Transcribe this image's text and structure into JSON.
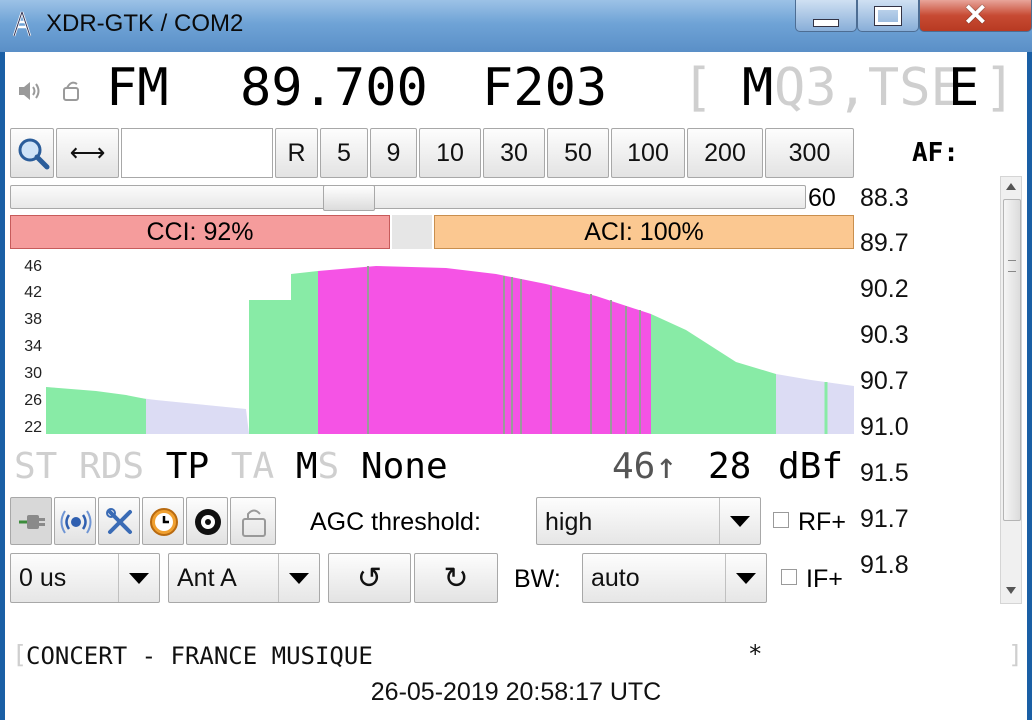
{
  "window": {
    "title": "XDR-GTK / COM2"
  },
  "tuner": {
    "band": "FM",
    "frequency": "89.700",
    "pi": "F203",
    "bracket_open": "[",
    "ps_m": "M",
    "ps_rest": "Q3,TSE",
    "ps_e": "E",
    "bracket_close": "]"
  },
  "toolbar": {
    "step_buttons": [
      "R",
      "5",
      "9",
      "10",
      "30",
      "50",
      "100",
      "200",
      "300"
    ],
    "af_label": "AF:"
  },
  "squelch": {
    "value": "60",
    "level": 0.42
  },
  "interference": {
    "cci": "CCI: 92%",
    "aci": "ACI: 100%"
  },
  "graph": {
    "y_ticks": [
      "46",
      "42",
      "38",
      "34",
      "30",
      "26",
      "22"
    ]
  },
  "af_list": [
    "88.3",
    "89.7",
    "90.2",
    "90.3",
    "90.7",
    "91.0",
    "91.5",
    "91.7",
    "91.8"
  ],
  "status": {
    "st": "ST",
    "rds": "RDS",
    "tp": "TP",
    "ta": "TA",
    "m": "M",
    "s": "S",
    "pty": "None",
    "peak": "46↑",
    "level": "28",
    "unit": "dBf"
  },
  "controls": {
    "agc_label": "AGC threshold:",
    "agc_value": "high",
    "rf_label": "RF+",
    "deemphasis": "0 us",
    "antenna": "Ant A",
    "bw_label": "BW:",
    "bw_value": "auto",
    "if_label": "IF+"
  },
  "radiotext": {
    "text": "CONCERT - FRANCE MUSIQUE",
    "marker": "*"
  },
  "clock": {
    "time": "26-05-2019 20:58:17 UTC"
  },
  "colors": {
    "green": "#88eba6",
    "lavender": "#dcdcf4",
    "magenta": "#f553e5",
    "cci": "#f59c9c",
    "aci": "#fbc891"
  }
}
